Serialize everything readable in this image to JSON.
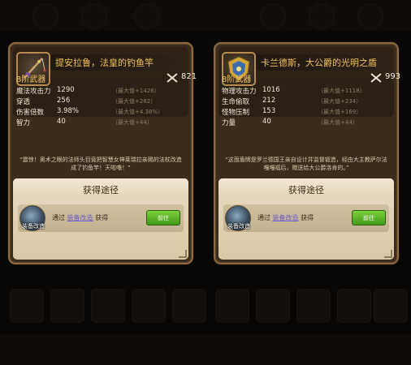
{
  "cards": [
    {
      "title": "提安拉鲁，法皇的钓鱼竿",
      "tier": "8阶武器",
      "power": "821",
      "stats": [
        {
          "name": "魔法攻击力",
          "value": "1290",
          "max": "（最大值+1426）"
        },
        {
          "name": "穿透",
          "value": "256",
          "max": "（最大值+282）"
        },
        {
          "name": "伤害倍数",
          "value": "3.98%",
          "max": "（最大值+4.38%）"
        },
        {
          "name": "智力",
          "value": "40",
          "max": "（最大值+44）"
        }
      ],
      "description": "“震惊！奥术之眼的法师头目竟把智慧女神莱瑞拉亲赐的法杖改造成了钓鱼竿！天啦噜！”",
      "acquire_title": "获得途径",
      "source_label": "装备改造",
      "source_prefix": "通过",
      "source_link": "装备改造",
      "source_suffix": "获得",
      "go_label": "前往",
      "icon": "fishing-rod-icon"
    },
    {
      "title": "卡兰德斯，大公爵的光明之盾",
      "tier": "8阶武器",
      "power": "993",
      "stats": [
        {
          "name": "物理攻击力",
          "value": "1016",
          "max": "（最大值+1118）"
        },
        {
          "name": "生命偷取",
          "value": "212",
          "max": "（最大值+234）"
        },
        {
          "name": "怪物压制",
          "value": "153",
          "max": "（最大值+169）"
        },
        {
          "name": "力量",
          "value": "40",
          "max": "（最大值+44）"
        }
      ],
      "description": "“这面盾牌是罗兰德国王亲自设计并监督锻造，经由大主教萨尔法嘎嘎福后，赠送给大公爵洛肯的。”",
      "acquire_title": "获得途径",
      "source_label": "装备改造",
      "source_prefix": "通过",
      "source_link": "装备改造",
      "source_suffix": "获得",
      "go_label": "前往",
      "icon": "golden-shield-icon"
    }
  ],
  "colors": {
    "title": "#f2c15a",
    "go_button": "#5cb52a",
    "link": "#6a5cc8"
  }
}
